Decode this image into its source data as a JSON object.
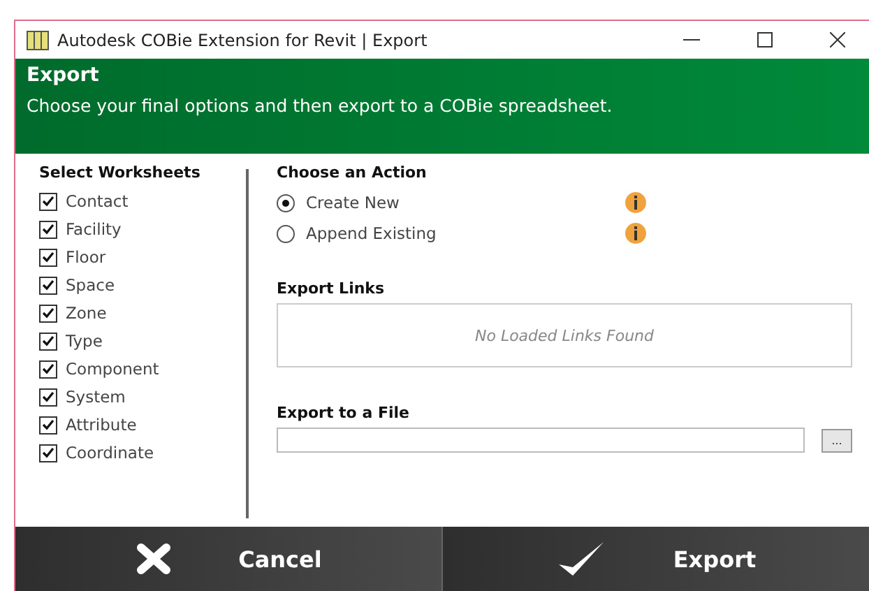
{
  "window": {
    "title": "Autodesk COBie Extension for Revit | Export"
  },
  "header": {
    "title": "Export",
    "subtitle": "Choose your final options and then export to a COBie spreadsheet."
  },
  "worksheets": {
    "title": "Select Worksheets",
    "items": [
      {
        "label": "Contact",
        "checked": true
      },
      {
        "label": "Facility",
        "checked": true
      },
      {
        "label": "Floor",
        "checked": true
      },
      {
        "label": "Space",
        "checked": true
      },
      {
        "label": "Zone",
        "checked": true
      },
      {
        "label": "Type",
        "checked": true
      },
      {
        "label": "Component",
        "checked": true
      },
      {
        "label": "System",
        "checked": true
      },
      {
        "label": "Attribute",
        "checked": true
      },
      {
        "label": "Coordinate",
        "checked": true
      }
    ]
  },
  "action": {
    "title": "Choose an Action",
    "options": [
      {
        "label": "Create New",
        "selected": true
      },
      {
        "label": "Append Existing",
        "selected": false
      }
    ]
  },
  "export_links": {
    "title": "Export Links",
    "empty_text": "No Loaded Links Found"
  },
  "export_file": {
    "title": "Export to a File",
    "browse": "..."
  },
  "buttons": [
    {
      "kind": "cancel",
      "label": "Cancel"
    },
    {
      "kind": "export",
      "label": "Export"
    }
  ]
}
